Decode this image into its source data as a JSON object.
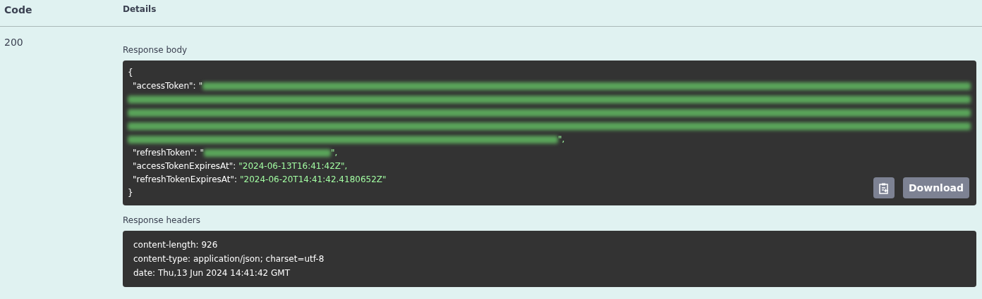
{
  "table": {
    "columns": [
      "Code",
      "Details"
    ],
    "rows": [
      {
        "code": "200",
        "response_body": {
          "label": "Response body",
          "open_brace": "{",
          "close_brace": "}",
          "entries": [
            {
              "key": "\"accessToken\":",
              "kind": "redacted-long",
              "open_quote": "\"",
              "close": "\","
            },
            {
              "key": "\"refreshToken\":",
              "kind": "redacted-short",
              "open_quote": "\"",
              "close": "\","
            },
            {
              "key": "\"accessTokenExpiresAt\":",
              "kind": "string",
              "value": "\"2024-06-13T16:41:42Z\","
            },
            {
              "key": "\"refreshTokenExpiresAt\":",
              "kind": "string",
              "value": "\"2024-06-20T14:41:42.4180652Z\""
            }
          ],
          "buttons": [
            {
              "kind": "copy"
            },
            {
              "kind": "text",
              "label": "Download"
            }
          ]
        },
        "response_headers": {
          "label": "Response headers",
          "lines": [
            "content-length: 926",
            "content-type: application/json; charset=utf-8",
            "date: Thu,13 Jun 2024 14:41:42 GMT"
          ]
        }
      }
    ]
  }
}
